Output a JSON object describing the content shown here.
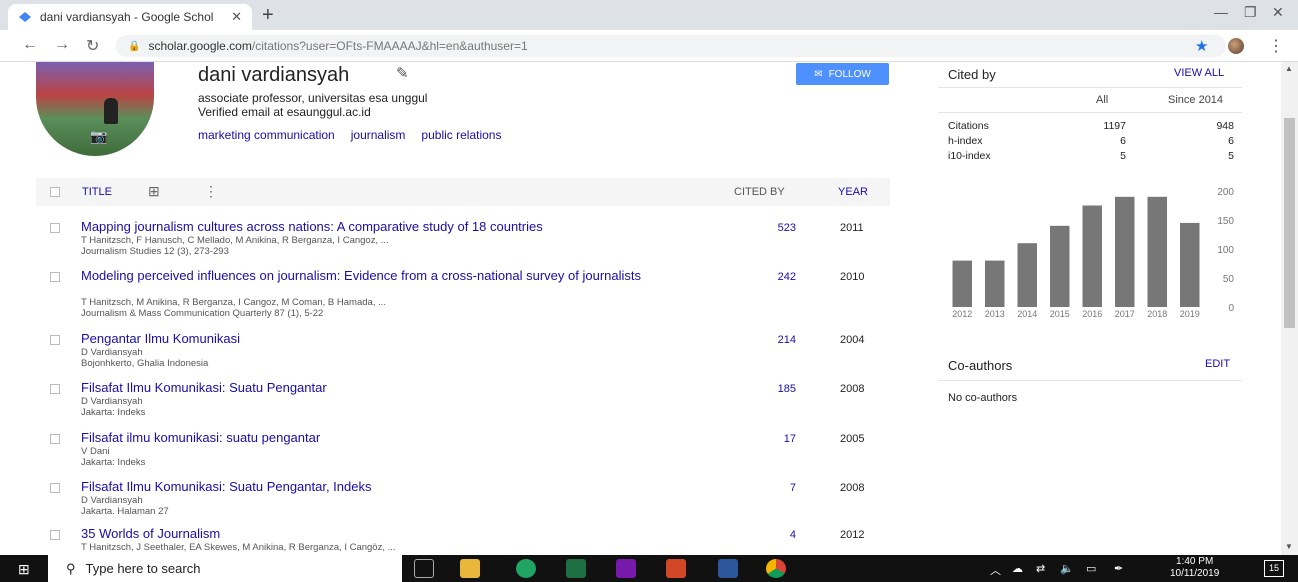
{
  "browser": {
    "tab_title": "dani vardiansyah - Google Schol",
    "url_main": "scholar.google.com",
    "url_path": "/citations?user=OFts-FMAAAAJ&hl=en&authuser=1"
  },
  "profile": {
    "name": "dani vardiansyah",
    "affiliation": "associate professor, universitas esa unggul",
    "email": "Verified email at esaunggul.ac.id",
    "interests": [
      "marketing communication",
      "journalism",
      "public relations"
    ],
    "follow_label": "FOLLOW"
  },
  "table": {
    "title_label": "TITLE",
    "cited_by_label": "CITED BY",
    "year_label": "YEAR",
    "rows": [
      {
        "title": "Mapping journalism cultures across nations: A comparative study of 18 countries",
        "authors": "T Hanitzsch, F Hanusch, C Mellado, M Anikina, R Berganza, I Cangoz, ...",
        "venue": "Journalism Studies 12 (3), 273-293",
        "cited": "523",
        "year": "2011"
      },
      {
        "title": "Modeling perceived influences on journalism: Evidence from a cross-national survey of journalists",
        "authors": "T Hanitzsch, M Anikina, R Berganza, I Cangoz, M Coman, B Hamada, ...",
        "venue": "Journalism & Mass Communication Quarterly 87 (1), 5-22",
        "cited": "242",
        "year": "2010"
      },
      {
        "title": "Pengantar Ilmu Komunikasi",
        "authors": "D Vardiansyah",
        "venue": "Bojonhkerto, Ghalia Indonesia",
        "cited": "214",
        "year": "2004"
      },
      {
        "title": "Filsafat Ilmu Komunikasi: Suatu Pengantar",
        "authors": "D Vardiansyah",
        "venue": "Jakarta: Indeks",
        "cited": "185",
        "year": "2008"
      },
      {
        "title": "Filsafat ilmu komunikasi: suatu pengantar",
        "authors": "V Dani",
        "venue": "Jakarta: Indeks",
        "cited": "17",
        "year": "2005"
      },
      {
        "title": "Filsafat Ilmu Komunikasi: Suatu Pengantar, Indeks",
        "authors": "D Vardiansyah",
        "venue": "Jakarta. Halaman 27",
        "cited": "7",
        "year": "2008"
      },
      {
        "title": "35 Worlds of Journalism",
        "authors": "T Hanitzsch, J Seethaler, EA Skewes, M Anikina, R Berganza, I Cangöz, ...",
        "venue": "",
        "cited": "4",
        "year": "2012"
      }
    ]
  },
  "cited_by": {
    "heading": "Cited by",
    "view_all": "VIEW ALL",
    "col_all": "All",
    "col_since": "Since 2014",
    "stats": [
      {
        "label": "Citations",
        "all": "1197",
        "since": "948"
      },
      {
        "label": "h-index",
        "all": "6",
        "since": "6"
      },
      {
        "label": "i10-index",
        "all": "5",
        "since": "5"
      }
    ]
  },
  "chart_data": {
    "type": "bar",
    "categories": [
      "2012",
      "2013",
      "2014",
      "2015",
      "2016",
      "2017",
      "2018",
      "2019"
    ],
    "values": [
      80,
      80,
      110,
      140,
      175,
      190,
      190,
      145
    ],
    "yticks": [
      0,
      50,
      100,
      150,
      200
    ],
    "ylim": [
      0,
      200
    ],
    "color": "#777777"
  },
  "coauthors": {
    "heading": "Co-authors",
    "edit": "EDIT",
    "none": "No co-authors"
  },
  "taskbar": {
    "search_placeholder": "Type here to search",
    "time": "1:40 PM",
    "date": "10/11/2019",
    "notifications": "15"
  }
}
